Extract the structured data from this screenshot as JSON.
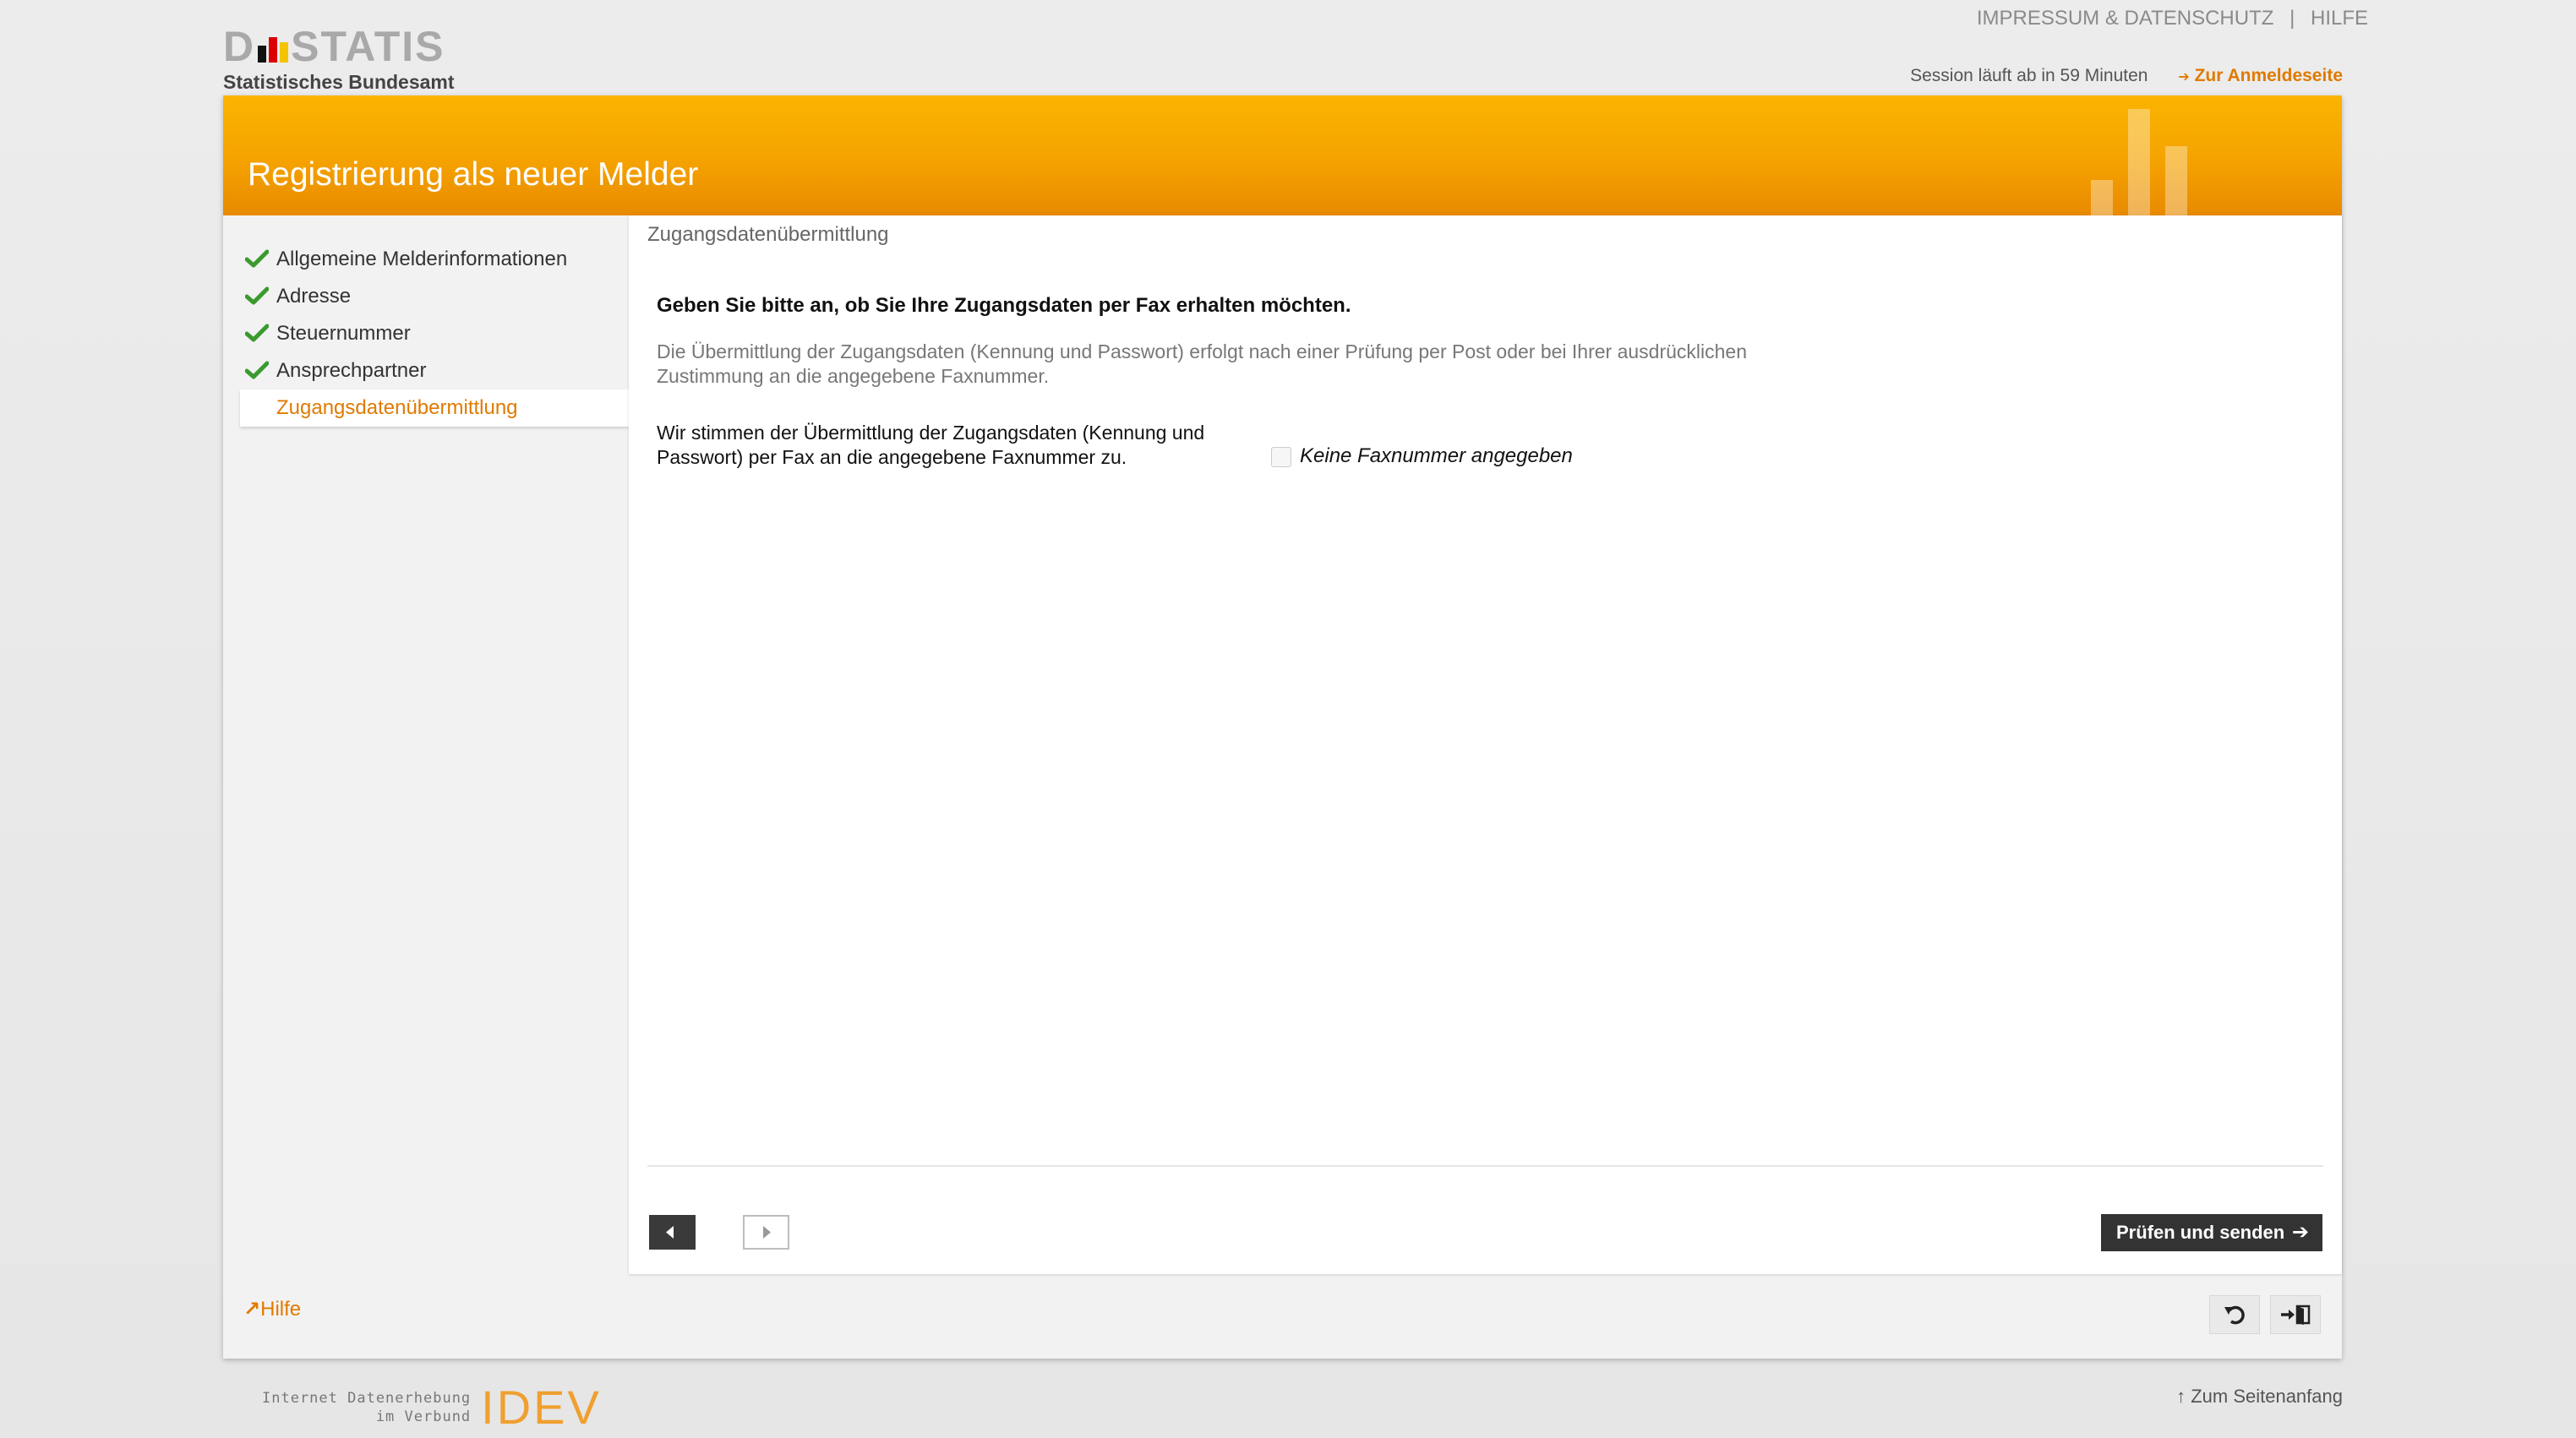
{
  "header": {
    "logo_text": "D STATIS",
    "logo_subtitle": "Statistisches Bundesamt",
    "impressum": "IMPRESSUM & DATENSCHUTZ",
    "separator": "|",
    "help": "HILFE",
    "session": "Session läuft ab in 59 Minuten",
    "login_link": "Zur Anmeldeseite",
    "login_arrow": "➔"
  },
  "banner": {
    "title": "Registrierung als neuer Melder"
  },
  "sidebar": {
    "items": [
      {
        "label": "Allgemeine Melderinformationen",
        "completed": true
      },
      {
        "label": "Adresse",
        "completed": true
      },
      {
        "label": "Steuernummer",
        "completed": true
      },
      {
        "label": "Ansprechpartner",
        "completed": true
      },
      {
        "label": "Zugangsdatenübermittlung",
        "completed": false,
        "active": true
      }
    ],
    "help": "Hilfe",
    "help_icon": "↗"
  },
  "content": {
    "section_title": "Zugangsdatenübermittlung",
    "question": "Geben Sie bitte an, ob Sie Ihre Zugangsdaten per Fax erhalten möchten.",
    "info": "Die Übermittlung der Zugangsdaten (Kennung und Passwort) erfolgt nach einer Prüfung per Post oder bei Ihrer ausdrücklichen Zustimmung an die angegebene Faxnummer.",
    "consent_label": "Wir stimmen der Übermittlung der Zugangsdaten (Kennung und Passwort) per Fax an die angegebene Faxnummer zu.",
    "fax_checkbox_checked": false,
    "fax_label": "Keine Faxnummer angegeben",
    "submit_label": "Prüfen und senden",
    "submit_arrow": "➔"
  },
  "footer": {
    "brand_line1": "Internet Datenerhebung",
    "brand_line2": "im Verbund",
    "brand_logo": "IDEV",
    "top_link": "↑ Zum Seitenanfang"
  },
  "colors": {
    "accent": "#e07a00",
    "banner": "#f5a200",
    "check": "#3b9a2f"
  },
  "icons": [
    "check-icon",
    "arrow-left-icon",
    "arrow-right-icon",
    "undo-icon",
    "exit-icon",
    "external-link-icon"
  ]
}
